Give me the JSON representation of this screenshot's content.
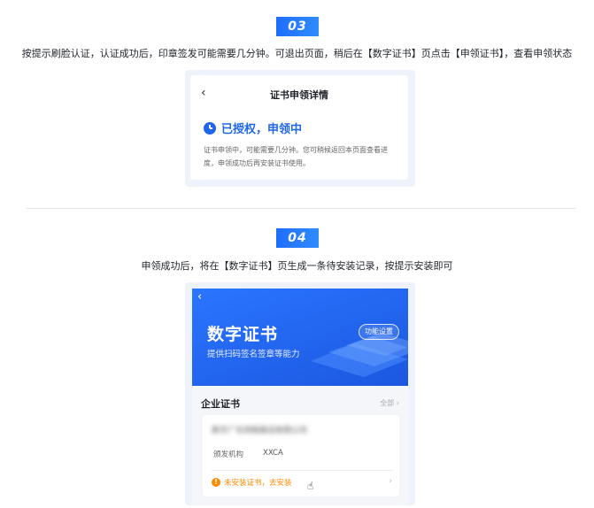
{
  "steps": [
    {
      "number": "03",
      "description": "按提示刷脸认证，认证成功后，印章签发可能需要几分钟。可退出页面，稍后在【数字证书】页点击【申领证书】，查看申领状态"
    },
    {
      "number": "04",
      "description": "申领成功后，将在【数字证书】页生成一条待安装记录，按提示安装即可"
    }
  ],
  "detail_card": {
    "back_icon": "chevron-left-icon",
    "title": "证书申领详情",
    "status_icon": "clock-icon",
    "status_text": "已授权，申领中",
    "status_color": "#1f66e8",
    "note": "证书申领中，可能需要几分钟。您可稍候返回本页面查看进度，申领成功后再安装证书使用。"
  },
  "cert_screen": {
    "banner_title": "数字证书",
    "banner_subtitle": "提供扫码签名签章等能力",
    "function_button": "功能设置",
    "section_title": "企业证书",
    "view_all": "全部 ›",
    "card": {
      "company_name": "数字广东网络建设有限公司",
      "issuer_label": "颁发机构",
      "issuer_value": "XXCA",
      "warning_text": "未安装证书，去安装",
      "warning_color": "#ff8a00"
    }
  },
  "accent_color": "#1f6dff"
}
